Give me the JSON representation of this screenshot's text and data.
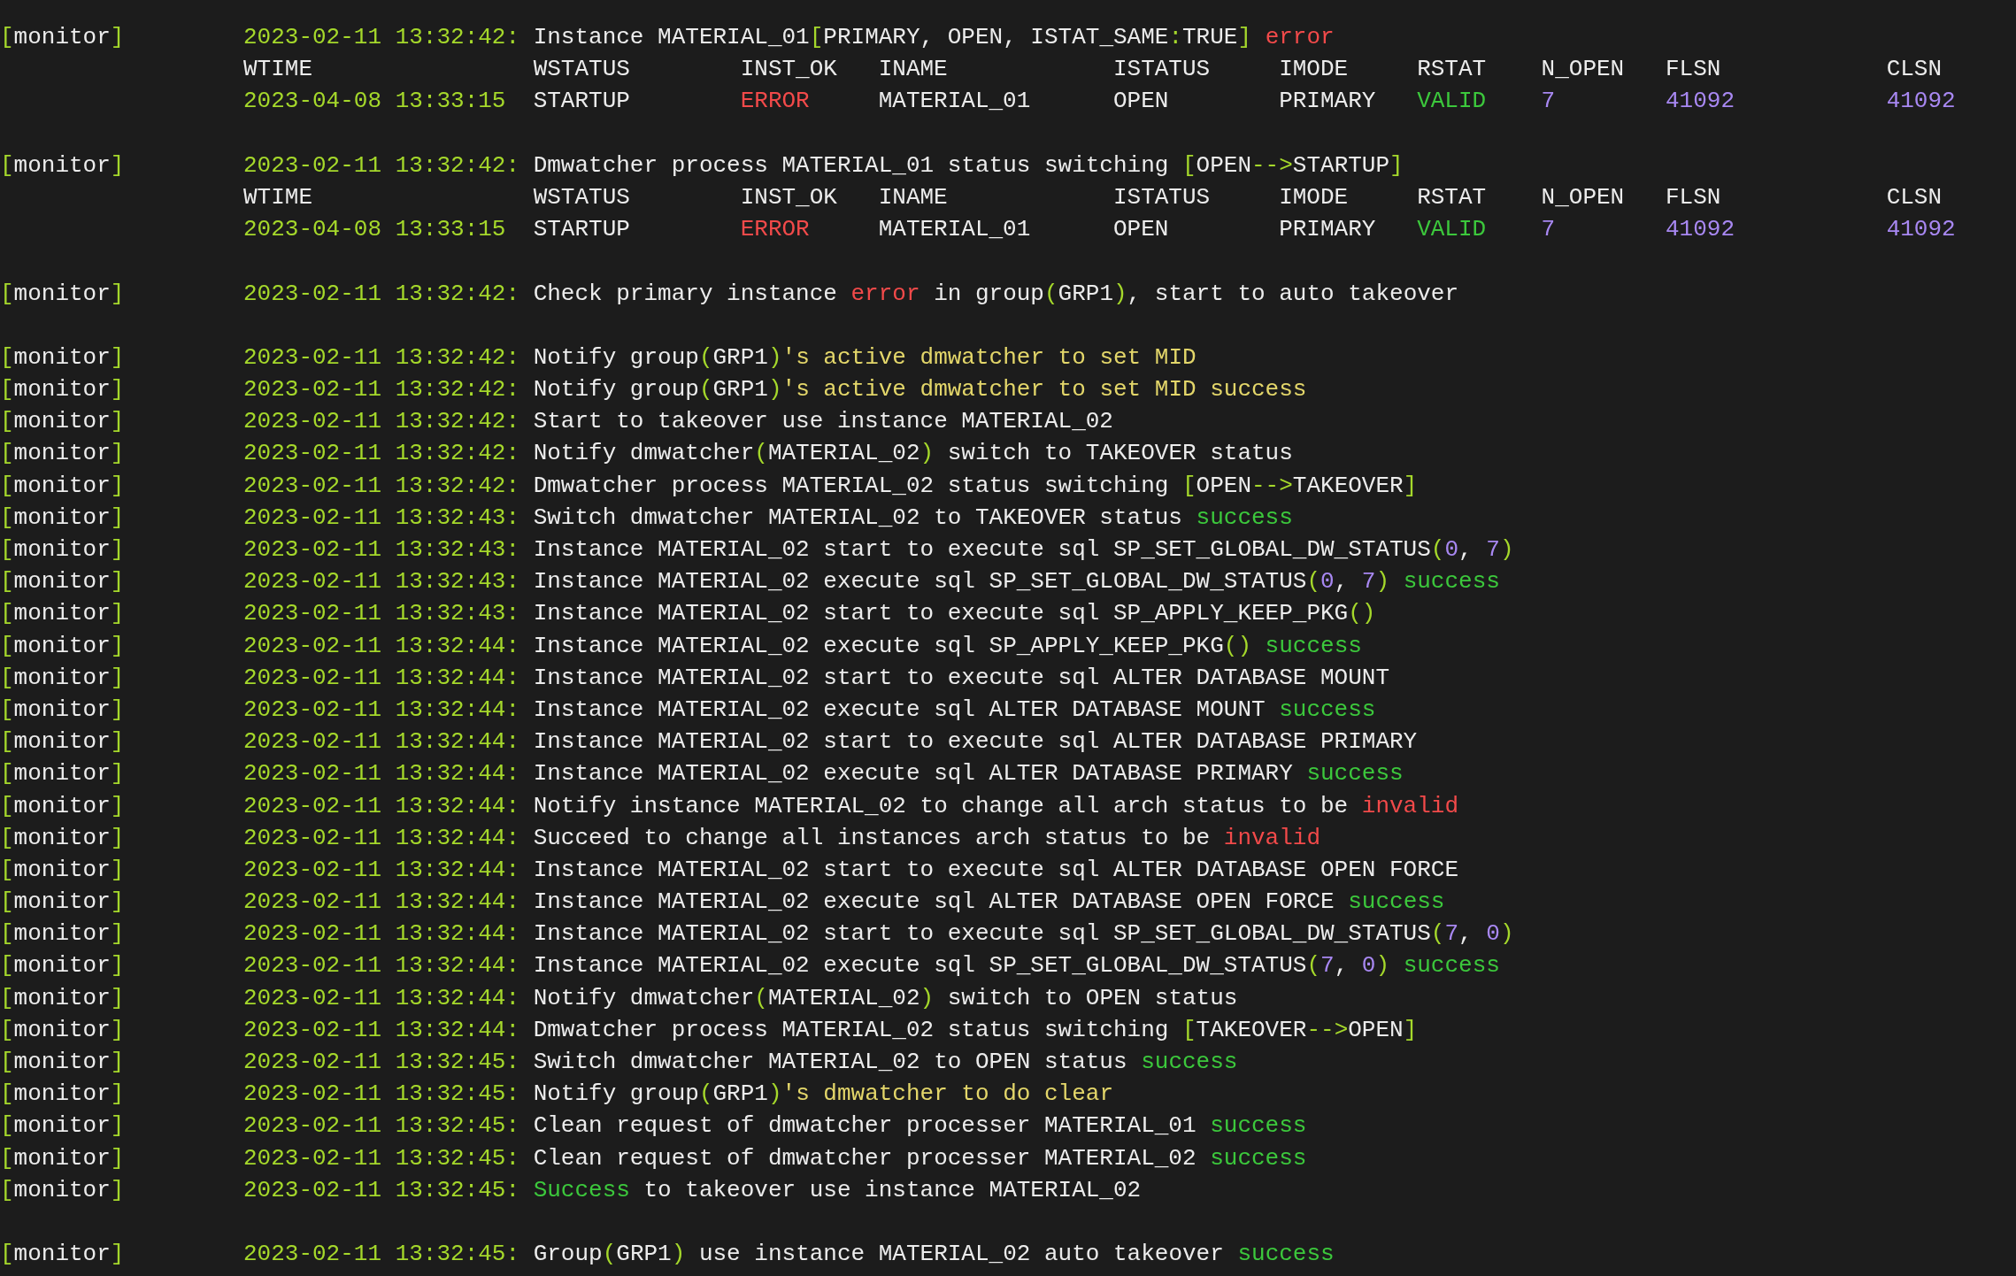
{
  "blocks": [
    {
      "entries": [
        {
          "kind": "log",
          "source": {
            "open": "[",
            "name": "monitor",
            "close": "]"
          },
          "time": "2023-02-11 13:32:42:",
          "message": [
            {
              "text": "Instance MATERIAL_01",
              "kind": "plain"
            },
            {
              "text": "[",
              "kind": "punct"
            },
            {
              "text": "PRIMARY, OPEN, ISTAT_SAME",
              "kind": "plain"
            },
            {
              "text": ":",
              "kind": "punct"
            },
            {
              "text": "TRUE",
              "kind": "plain"
            },
            {
              "text": "]",
              "kind": "punct"
            },
            {
              "text": " error",
              "kind": "error"
            }
          ]
        },
        {
          "kind": "table",
          "columns": [
            "WTIME",
            "WSTATUS",
            "INST_OK",
            "INAME",
            "ISTATUS",
            "IMODE",
            "RSTAT",
            "N_OPEN",
            "FLSN",
            "CLSN"
          ],
          "values": [
            {
              "text": "2023-04-08 13:33:15",
              "kind": "punct"
            },
            {
              "text": "STARTUP",
              "kind": "plain"
            },
            {
              "text": "ERROR",
              "kind": "error"
            },
            {
              "text": "MATERIAL_01",
              "kind": "plain"
            },
            {
              "text": "OPEN",
              "kind": "plain"
            },
            {
              "text": "PRIMARY",
              "kind": "plain"
            },
            {
              "text": "VALID",
              "kind": "success"
            },
            {
              "text": "7",
              "kind": "number"
            },
            {
              "text": "41092",
              "kind": "number"
            },
            {
              "text": "41092",
              "kind": "number"
            }
          ]
        }
      ]
    },
    {
      "entries": [
        {
          "kind": "log",
          "source": {
            "open": "[",
            "name": "monitor",
            "close": "]"
          },
          "time": "2023-02-11 13:32:42:",
          "message": [
            {
              "text": "Dmwatcher process MATERIAL_01 status switching ",
              "kind": "plain"
            },
            {
              "text": "[",
              "kind": "punct"
            },
            {
              "text": "OPEN",
              "kind": "plain"
            },
            {
              "text": "-->",
              "kind": "punct"
            },
            {
              "text": "STARTUP",
              "kind": "plain"
            },
            {
              "text": "]",
              "kind": "punct"
            }
          ]
        },
        {
          "kind": "table",
          "columns": [
            "WTIME",
            "WSTATUS",
            "INST_OK",
            "INAME",
            "ISTATUS",
            "IMODE",
            "RSTAT",
            "N_OPEN",
            "FLSN",
            "CLSN"
          ],
          "values": [
            {
              "text": "2023-04-08 13:33:15",
              "kind": "punct"
            },
            {
              "text": "STARTUP",
              "kind": "plain"
            },
            {
              "text": "ERROR",
              "kind": "error"
            },
            {
              "text": "MATERIAL_01",
              "kind": "plain"
            },
            {
              "text": "OPEN",
              "kind": "plain"
            },
            {
              "text": "PRIMARY",
              "kind": "plain"
            },
            {
              "text": "VALID",
              "kind": "success"
            },
            {
              "text": "7",
              "kind": "number"
            },
            {
              "text": "41092",
              "kind": "number"
            },
            {
              "text": "41092",
              "kind": "number"
            }
          ]
        }
      ]
    },
    {
      "entries": [
        {
          "kind": "log",
          "source": {
            "open": "[",
            "name": "monitor",
            "close": "]"
          },
          "time": "2023-02-11 13:32:42:",
          "message": [
            {
              "text": "Check primary instance ",
              "kind": "plain"
            },
            {
              "text": "error",
              "kind": "error"
            },
            {
              "text": " in group",
              "kind": "plain"
            },
            {
              "text": "(",
              "kind": "punct"
            },
            {
              "text": "GRP1",
              "kind": "plain"
            },
            {
              "text": ")",
              "kind": "punct"
            },
            {
              "text": ", start to auto takeover",
              "kind": "plain"
            }
          ]
        }
      ]
    },
    {
      "entries": [
        {
          "kind": "log",
          "source": {
            "open": "[",
            "name": "monitor",
            "close": "]"
          },
          "time": "2023-02-11 13:32:42:",
          "message": [
            {
              "text": "Notify group",
              "kind": "plain"
            },
            {
              "text": "(",
              "kind": "punct"
            },
            {
              "text": "GRP1",
              "kind": "plain"
            },
            {
              "text": ")",
              "kind": "punct"
            },
            {
              "text": "'s active dmwatcher to set MID",
              "kind": "note"
            }
          ]
        },
        {
          "kind": "log",
          "source": {
            "open": "[",
            "name": "monitor",
            "close": "]"
          },
          "time": "2023-02-11 13:32:42:",
          "message": [
            {
              "text": "Notify group",
              "kind": "plain"
            },
            {
              "text": "(",
              "kind": "punct"
            },
            {
              "text": "GRP1",
              "kind": "plain"
            },
            {
              "text": ")",
              "kind": "punct"
            },
            {
              "text": "'s active dmwatcher to set MID success",
              "kind": "note"
            }
          ]
        },
        {
          "kind": "log",
          "source": {
            "open": "[",
            "name": "monitor",
            "close": "]"
          },
          "time": "2023-02-11 13:32:42:",
          "message": [
            {
              "text": "Start to takeover use instance MATERIAL_02",
              "kind": "plain"
            }
          ]
        },
        {
          "kind": "log",
          "source": {
            "open": "[",
            "name": "monitor",
            "close": "]"
          },
          "time": "2023-02-11 13:32:42:",
          "message": [
            {
              "text": "Notify dmwatcher",
              "kind": "plain"
            },
            {
              "text": "(",
              "kind": "punct"
            },
            {
              "text": "MATERIAL_02",
              "kind": "plain"
            },
            {
              "text": ")",
              "kind": "punct"
            },
            {
              "text": " switch to TAKEOVER status",
              "kind": "plain"
            }
          ]
        },
        {
          "kind": "log",
          "source": {
            "open": "[",
            "name": "monitor",
            "close": "]"
          },
          "time": "2023-02-11 13:32:42:",
          "message": [
            {
              "text": "Dmwatcher process MATERIAL_02 status switching ",
              "kind": "plain"
            },
            {
              "text": "[",
              "kind": "punct"
            },
            {
              "text": "OPEN",
              "kind": "plain"
            },
            {
              "text": "-->",
              "kind": "punct"
            },
            {
              "text": "TAKEOVER",
              "kind": "plain"
            },
            {
              "text": "]",
              "kind": "punct"
            }
          ]
        },
        {
          "kind": "log",
          "source": {
            "open": "[",
            "name": "monitor",
            "close": "]"
          },
          "time": "2023-02-11 13:32:43:",
          "message": [
            {
              "text": "Switch dmwatcher MATERIAL_02 to TAKEOVER status ",
              "kind": "plain"
            },
            {
              "text": "success",
              "kind": "success"
            }
          ]
        },
        {
          "kind": "log",
          "source": {
            "open": "[",
            "name": "monitor",
            "close": "]"
          },
          "time": "2023-02-11 13:32:43:",
          "message": [
            {
              "text": "Instance MATERIAL_02 start to execute sql SP_SET_GLOBAL_DW_STATUS",
              "kind": "plain"
            },
            {
              "text": "(",
              "kind": "punct"
            },
            {
              "text": "0",
              "kind": "number"
            },
            {
              "text": ", ",
              "kind": "plain"
            },
            {
              "text": "7",
              "kind": "number"
            },
            {
              "text": ")",
              "kind": "punct"
            }
          ]
        },
        {
          "kind": "log",
          "source": {
            "open": "[",
            "name": "monitor",
            "close": "]"
          },
          "time": "2023-02-11 13:32:43:",
          "message": [
            {
              "text": "Instance MATERIAL_02 execute sql SP_SET_GLOBAL_DW_STATUS",
              "kind": "plain"
            },
            {
              "text": "(",
              "kind": "punct"
            },
            {
              "text": "0",
              "kind": "number"
            },
            {
              "text": ", ",
              "kind": "plain"
            },
            {
              "text": "7",
              "kind": "number"
            },
            {
              "text": ")",
              "kind": "punct"
            },
            {
              "text": " success",
              "kind": "success"
            }
          ]
        },
        {
          "kind": "log",
          "source": {
            "open": "[",
            "name": "monitor",
            "close": "]"
          },
          "time": "2023-02-11 13:32:43:",
          "message": [
            {
              "text": "Instance MATERIAL_02 start to execute sql SP_APPLY_KEEP_PKG",
              "kind": "plain"
            },
            {
              "text": "()",
              "kind": "punct"
            }
          ]
        },
        {
          "kind": "log",
          "source": {
            "open": "[",
            "name": "monitor",
            "close": "]"
          },
          "time": "2023-02-11 13:32:44:",
          "message": [
            {
              "text": "Instance MATERIAL_02 execute sql SP_APPLY_KEEP_PKG",
              "kind": "plain"
            },
            {
              "text": "()",
              "kind": "punct"
            },
            {
              "text": " success",
              "kind": "success"
            }
          ]
        },
        {
          "kind": "log",
          "source": {
            "open": "[",
            "name": "monitor",
            "close": "]"
          },
          "time": "2023-02-11 13:32:44:",
          "message": [
            {
              "text": "Instance MATERIAL_02 start to execute sql ALTER DATABASE MOUNT",
              "kind": "plain"
            }
          ]
        },
        {
          "kind": "log",
          "source": {
            "open": "[",
            "name": "monitor",
            "close": "]"
          },
          "time": "2023-02-11 13:32:44:",
          "message": [
            {
              "text": "Instance MATERIAL_02 execute sql ALTER DATABASE MOUNT ",
              "kind": "plain"
            },
            {
              "text": "success",
              "kind": "success"
            }
          ]
        },
        {
          "kind": "log",
          "source": {
            "open": "[",
            "name": "monitor",
            "close": "]"
          },
          "time": "2023-02-11 13:32:44:",
          "message": [
            {
              "text": "Instance MATERIAL_02 start to execute sql ALTER DATABASE PRIMARY",
              "kind": "plain"
            }
          ]
        },
        {
          "kind": "log",
          "source": {
            "open": "[",
            "name": "monitor",
            "close": "]"
          },
          "time": "2023-02-11 13:32:44:",
          "message": [
            {
              "text": "Instance MATERIAL_02 execute sql ALTER DATABASE PRIMARY ",
              "kind": "plain"
            },
            {
              "text": "success",
              "kind": "success"
            }
          ]
        },
        {
          "kind": "log",
          "source": {
            "open": "[",
            "name": "monitor",
            "close": "]"
          },
          "time": "2023-02-11 13:32:44:",
          "message": [
            {
              "text": "Notify instance MATERIAL_02 to change all arch status to be ",
              "kind": "plain"
            },
            {
              "text": "invalid",
              "kind": "error"
            }
          ]
        },
        {
          "kind": "log",
          "source": {
            "open": "[",
            "name": "monitor",
            "close": "]"
          },
          "time": "2023-02-11 13:32:44:",
          "message": [
            {
              "text": "Succeed to change all instances arch status to be ",
              "kind": "plain"
            },
            {
              "text": "invalid",
              "kind": "error"
            }
          ]
        },
        {
          "kind": "log",
          "source": {
            "open": "[",
            "name": "monitor",
            "close": "]"
          },
          "time": "2023-02-11 13:32:44:",
          "message": [
            {
              "text": "Instance MATERIAL_02 start to execute sql ALTER DATABASE OPEN FORCE",
              "kind": "plain"
            }
          ]
        },
        {
          "kind": "log",
          "source": {
            "open": "[",
            "name": "monitor",
            "close": "]"
          },
          "time": "2023-02-11 13:32:44:",
          "message": [
            {
              "text": "Instance MATERIAL_02 execute sql ALTER DATABASE OPEN FORCE ",
              "kind": "plain"
            },
            {
              "text": "success",
              "kind": "success"
            }
          ]
        },
        {
          "kind": "log",
          "source": {
            "open": "[",
            "name": "monitor",
            "close": "]"
          },
          "time": "2023-02-11 13:32:44:",
          "message": [
            {
              "text": "Instance MATERIAL_02 start to execute sql SP_SET_GLOBAL_DW_STATUS",
              "kind": "plain"
            },
            {
              "text": "(",
              "kind": "punct"
            },
            {
              "text": "7",
              "kind": "number"
            },
            {
              "text": ", ",
              "kind": "plain"
            },
            {
              "text": "0",
              "kind": "number"
            },
            {
              "text": ")",
              "kind": "punct"
            }
          ]
        },
        {
          "kind": "log",
          "source": {
            "open": "[",
            "name": "monitor",
            "close": "]"
          },
          "time": "2023-02-11 13:32:44:",
          "message": [
            {
              "text": "Instance MATERIAL_02 execute sql SP_SET_GLOBAL_DW_STATUS",
              "kind": "plain"
            },
            {
              "text": "(",
              "kind": "punct"
            },
            {
              "text": "7",
              "kind": "number"
            },
            {
              "text": ", ",
              "kind": "plain"
            },
            {
              "text": "0",
              "kind": "number"
            },
            {
              "text": ")",
              "kind": "punct"
            },
            {
              "text": " success",
              "kind": "success"
            }
          ]
        },
        {
          "kind": "log",
          "source": {
            "open": "[",
            "name": "monitor",
            "close": "]"
          },
          "time": "2023-02-11 13:32:44:",
          "message": [
            {
              "text": "Notify dmwatcher",
              "kind": "plain"
            },
            {
              "text": "(",
              "kind": "punct"
            },
            {
              "text": "MATERIAL_02",
              "kind": "plain"
            },
            {
              "text": ")",
              "kind": "punct"
            },
            {
              "text": " switch to OPEN status",
              "kind": "plain"
            }
          ]
        },
        {
          "kind": "log",
          "source": {
            "open": "[",
            "name": "monitor",
            "close": "]"
          },
          "time": "2023-02-11 13:32:44:",
          "message": [
            {
              "text": "Dmwatcher process MATERIAL_02 status switching ",
              "kind": "plain"
            },
            {
              "text": "[",
              "kind": "punct"
            },
            {
              "text": "TAKEOVER",
              "kind": "plain"
            },
            {
              "text": "-->",
              "kind": "punct"
            },
            {
              "text": "OPEN",
              "kind": "plain"
            },
            {
              "text": "]",
              "kind": "punct"
            }
          ]
        },
        {
          "kind": "log",
          "source": {
            "open": "[",
            "name": "monitor",
            "close": "]"
          },
          "time": "2023-02-11 13:32:45:",
          "message": [
            {
              "text": "Switch dmwatcher MATERIAL_02 to OPEN status ",
              "kind": "plain"
            },
            {
              "text": "success",
              "kind": "success"
            }
          ]
        },
        {
          "kind": "log",
          "source": {
            "open": "[",
            "name": "monitor",
            "close": "]"
          },
          "time": "2023-02-11 13:32:45:",
          "message": [
            {
              "text": "Notify group",
              "kind": "plain"
            },
            {
              "text": "(",
              "kind": "punct"
            },
            {
              "text": "GRP1",
              "kind": "plain"
            },
            {
              "text": ")",
              "kind": "punct"
            },
            {
              "text": "'s dmwatcher to do clear",
              "kind": "note"
            }
          ]
        },
        {
          "kind": "log",
          "source": {
            "open": "[",
            "name": "monitor",
            "close": "]"
          },
          "time": "2023-02-11 13:32:45:",
          "message": [
            {
              "text": "Clean request of dmwatcher processer MATERIAL_01 ",
              "kind": "plain"
            },
            {
              "text": "success",
              "kind": "success"
            }
          ]
        },
        {
          "kind": "log",
          "source": {
            "open": "[",
            "name": "monitor",
            "close": "]"
          },
          "time": "2023-02-11 13:32:45:",
          "message": [
            {
              "text": "Clean request of dmwatcher processer MATERIAL_02 ",
              "kind": "plain"
            },
            {
              "text": "success",
              "kind": "success"
            }
          ]
        },
        {
          "kind": "log",
          "source": {
            "open": "[",
            "name": "monitor",
            "close": "]"
          },
          "time": "2023-02-11 13:32:45:",
          "message": [
            {
              "text": "Success",
              "kind": "success"
            },
            {
              "text": " to takeover use instance MATERIAL_02",
              "kind": "plain"
            }
          ]
        }
      ]
    },
    {
      "entries": [
        {
          "kind": "log",
          "source": {
            "open": "[",
            "name": "monitor",
            "close": "]"
          },
          "time": "2023-02-11 13:32:45:",
          "message": [
            {
              "text": "Group",
              "kind": "plain"
            },
            {
              "text": "(",
              "kind": "punct"
            },
            {
              "text": "GRP1",
              "kind": "plain"
            },
            {
              "text": ")",
              "kind": "punct"
            },
            {
              "text": " use instance MATERIAL_02 auto takeover ",
              "kind": "plain"
            },
            {
              "text": "success",
              "kind": "success"
            }
          ]
        }
      ]
    }
  ]
}
